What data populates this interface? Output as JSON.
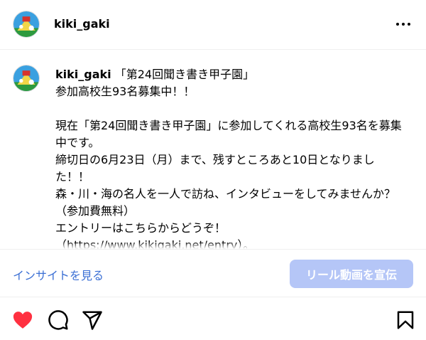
{
  "header": {
    "username": "kiki_gaki",
    "avatar_icon": "avatar-image",
    "more_icon": "more-options-icon"
  },
  "caption": {
    "username": "kiki_gaki",
    "text": " 「第24回聞き書き甲子園」\n参加高校生93名募集中！！\n\n現在「第24回聞き書き甲子園」に参加してくれる高校生93名を募集中です。\n締切日の6月23日（月）まで、残すところあと10日となりました！！\n森・川・海の名人を一人で訪ね、インタビューをしてみませんか？\n（参加費無料）\nエントリーはこちらからどうぞ！\n（https://www.kikigaki.net/entry）。"
  },
  "insight": {
    "link_label": "インサイトを見る",
    "promote_label": "リール動画を宣伝"
  },
  "actions": {
    "like_icon": "heart-icon",
    "like_color": "#ff3040",
    "comment_icon": "comment-icon",
    "share_icon": "share-icon",
    "save_icon": "bookmark-icon"
  },
  "colors": {
    "link": "#3b6fd4",
    "promote_button": "#b5c6f7"
  }
}
